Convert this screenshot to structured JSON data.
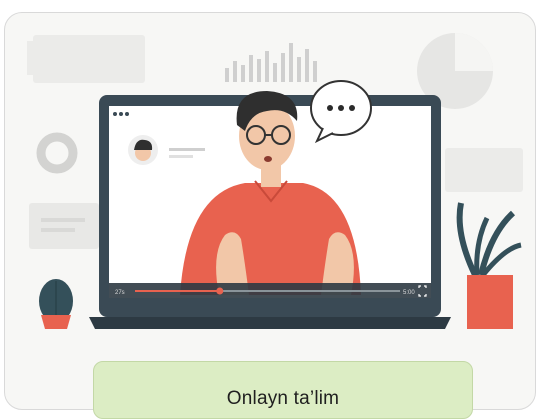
{
  "caption": {
    "text": "Onlayn ta’lim"
  },
  "video_player": {
    "time_current": "27s",
    "time_total": "5:00",
    "progress_fraction": 0.32
  },
  "icons": [
    "speech-bubble-icon",
    "fullscreen-icon",
    "cactus-icon",
    "plant-icon",
    "pie-chart-icon",
    "bar-chart-icon"
  ]
}
